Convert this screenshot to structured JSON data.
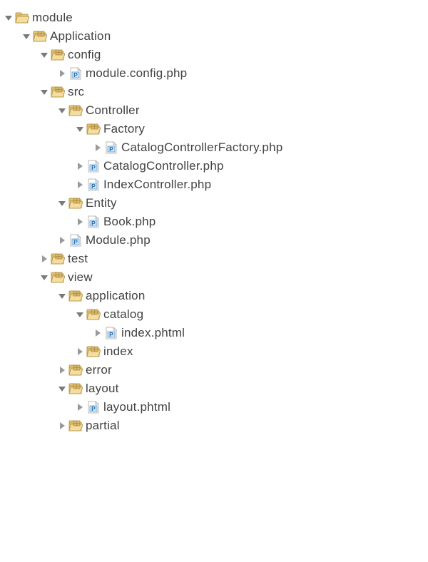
{
  "tree": [
    {
      "d": 0,
      "e": "open",
      "i": "folder-open",
      "l": "module"
    },
    {
      "d": 1,
      "e": "open",
      "i": "pkg-folder",
      "l": "Application"
    },
    {
      "d": 2,
      "e": "open",
      "i": "pkg-folder",
      "l": "config"
    },
    {
      "d": 3,
      "e": "closed",
      "i": "php",
      "l": "module.config.php"
    },
    {
      "d": 2,
      "e": "open",
      "i": "pkg-folder",
      "l": "src"
    },
    {
      "d": 3,
      "e": "open",
      "i": "pkg-folder",
      "l": "Controller"
    },
    {
      "d": 4,
      "e": "open",
      "i": "pkg-folder",
      "l": "Factory"
    },
    {
      "d": 5,
      "e": "closed",
      "i": "php",
      "l": "CatalogControllerFactory.php"
    },
    {
      "d": 4,
      "e": "closed",
      "i": "php",
      "l": "CatalogController.php"
    },
    {
      "d": 4,
      "e": "closed",
      "i": "php",
      "l": "IndexController.php"
    },
    {
      "d": 3,
      "e": "open",
      "i": "pkg-folder",
      "l": "Entity"
    },
    {
      "d": 4,
      "e": "closed",
      "i": "php",
      "l": "Book.php"
    },
    {
      "d": 3,
      "e": "closed",
      "i": "php",
      "l": "Module.php"
    },
    {
      "d": 2,
      "e": "closed",
      "i": "pkg-folder",
      "l": "test"
    },
    {
      "d": 2,
      "e": "open",
      "i": "pkg-folder",
      "l": "view"
    },
    {
      "d": 3,
      "e": "open",
      "i": "pkg-folder",
      "l": "application"
    },
    {
      "d": 4,
      "e": "open",
      "i": "pkg-folder",
      "l": "catalog"
    },
    {
      "d": 5,
      "e": "closed",
      "i": "php",
      "l": "index.phtml"
    },
    {
      "d": 4,
      "e": "closed",
      "i": "pkg-folder",
      "l": "index"
    },
    {
      "d": 3,
      "e": "closed",
      "i": "pkg-folder",
      "l": "error"
    },
    {
      "d": 3,
      "e": "open",
      "i": "pkg-folder",
      "l": "layout"
    },
    {
      "d": 4,
      "e": "closed",
      "i": "php",
      "l": "layout.phtml"
    },
    {
      "d": 3,
      "e": "closed",
      "i": "pkg-folder",
      "l": "partial"
    }
  ]
}
